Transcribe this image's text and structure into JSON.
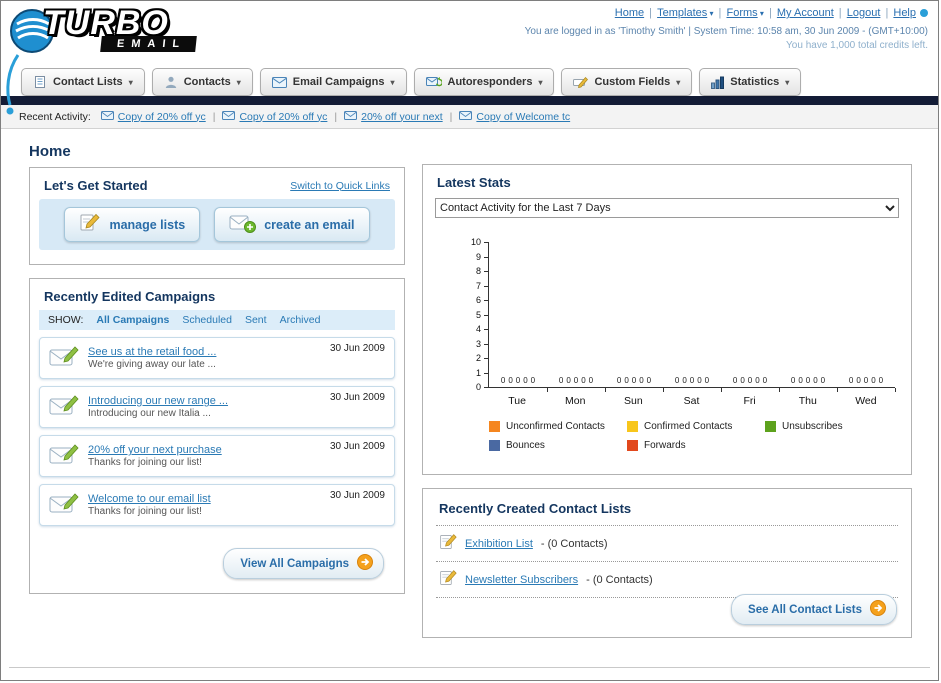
{
  "header": {
    "logo_text": "TURBO",
    "logo_sub": "EMAIL",
    "nav_links": [
      {
        "label": "Home",
        "dropdown": false
      },
      {
        "label": "Templates",
        "dropdown": true
      },
      {
        "label": "Forms",
        "dropdown": true
      },
      {
        "label": "My Account",
        "dropdown": false
      },
      {
        "label": "Logout",
        "dropdown": false
      },
      {
        "label": "Help",
        "dropdown": false
      }
    ],
    "login_info": "You are logged in as 'Timothy Smith' | System Time: 10:58 am, 30 Jun 2009 - (GMT+10:00)",
    "credits": "You have 1,000 total credits left."
  },
  "nav_tabs": [
    {
      "label": "Contact Lists",
      "icon": "contact-lists-icon"
    },
    {
      "label": "Contacts",
      "icon": "contacts-icon"
    },
    {
      "label": "Email Campaigns",
      "icon": "email-campaigns-icon"
    },
    {
      "label": "Autoresponders",
      "icon": "autoresponders-icon"
    },
    {
      "label": "Custom Fields",
      "icon": "custom-fields-icon"
    },
    {
      "label": "Statistics",
      "icon": "statistics-icon"
    }
  ],
  "recent_activity": {
    "label": "Recent Activity:",
    "items": [
      "Copy of 20% off yc",
      "Copy of 20% off yc",
      "20% off your next",
      "Copy of Welcome tc"
    ]
  },
  "page_title": "Home",
  "get_started": {
    "title": "Let's Get Started",
    "switch_link": "Switch to Quick Links",
    "manage_lists_label": "manage lists",
    "create_email_label": "create an email"
  },
  "campaigns": {
    "title": "Recently Edited Campaigns",
    "show_label": "SHOW:",
    "filters": [
      {
        "label": "All Campaigns",
        "active": true
      },
      {
        "label": "Scheduled",
        "active": false
      },
      {
        "label": "Sent",
        "active": false
      },
      {
        "label": "Archived",
        "active": false
      }
    ],
    "items": [
      {
        "title": "See us at the retail food ...",
        "subtitle": "We're giving away our late ...",
        "date": "30 Jun 2009"
      },
      {
        "title": "Introducing our new range ...",
        "subtitle": "Introducing our new Italia ...",
        "date": "30 Jun 2009"
      },
      {
        "title": "20% off your next purchase",
        "subtitle": "Thanks for joining our list!",
        "date": "30 Jun 2009"
      },
      {
        "title": "Welcome to our email list",
        "subtitle": "Thanks for joining our list!",
        "date": "30 Jun 2009"
      }
    ],
    "view_all_label": "View All Campaigns"
  },
  "stats": {
    "title": "Latest Stats",
    "period_selected": "Contact Activity for the Last 7 Days"
  },
  "chart_data": {
    "type": "bar",
    "title": "Contact Activity for the Last 7 Days",
    "categories": [
      "Tue",
      "Mon",
      "Sun",
      "Sat",
      "Fri",
      "Thu",
      "Wed"
    ],
    "series": [
      {
        "name": "Unconfirmed Contacts",
        "color": "#f5861f",
        "values": [
          0,
          0,
          0,
          0,
          0,
          0,
          0
        ]
      },
      {
        "name": "Confirmed Contacts",
        "color": "#f8c61c",
        "values": [
          0,
          0,
          0,
          0,
          0,
          0,
          0
        ]
      },
      {
        "name": "Unsubscribes",
        "color": "#5da21d",
        "values": [
          0,
          0,
          0,
          0,
          0,
          0,
          0
        ]
      },
      {
        "name": "Bounces",
        "color": "#4a69a2",
        "values": [
          0,
          0,
          0,
          0,
          0,
          0,
          0
        ]
      },
      {
        "name": "Forwards",
        "color": "#e2481d",
        "values": [
          0,
          0,
          0,
          0,
          0,
          0,
          0
        ]
      }
    ],
    "ylim": [
      0,
      10
    ],
    "ytick_step": 1,
    "grid": false,
    "legend_position": "bottom"
  },
  "contact_lists": {
    "title": "Recently Created Contact Lists",
    "items": [
      {
        "name": "Exhibition List",
        "detail": "- (0 Contacts)"
      },
      {
        "name": "Newsletter Subscribers",
        "detail": "- (0 Contacts)"
      }
    ],
    "see_all_label": "See All Contact Lists"
  }
}
